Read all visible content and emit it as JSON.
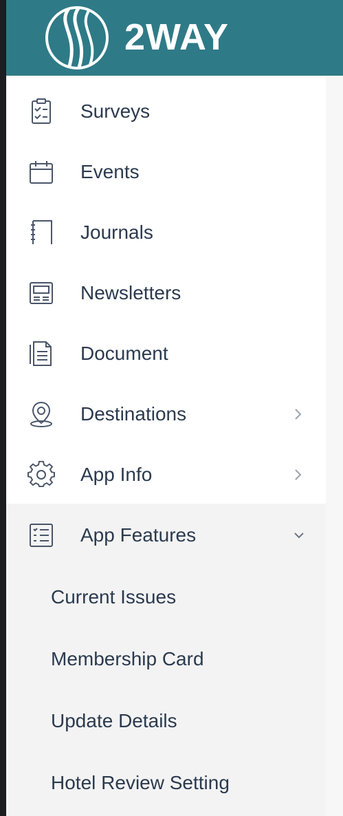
{
  "brand": {
    "name": "2WAY",
    "logo_icon": "wave-logo-icon",
    "color": "#2f7a87"
  },
  "nav": {
    "items": [
      {
        "label": "Surveys",
        "icon": "survey-clipboard-icon"
      },
      {
        "label": "Events",
        "icon": "calendar-icon"
      },
      {
        "label": "Journals",
        "icon": "journal-icon"
      },
      {
        "label": "Newsletters",
        "icon": "newsletter-icon"
      },
      {
        "label": "Document",
        "icon": "document-icon"
      },
      {
        "label": "Destinations",
        "icon": "map-pin-icon",
        "has_children": true
      },
      {
        "label": "App Info",
        "icon": "gear-icon",
        "has_children": true
      },
      {
        "label": "App Features",
        "icon": "list-icon",
        "has_children": true,
        "expanded": true
      }
    ],
    "subitems": [
      {
        "label": "Current Issues"
      },
      {
        "label": "Membership Card"
      },
      {
        "label": "Update Details"
      },
      {
        "label": "Hotel Review Setting"
      }
    ]
  },
  "colors": {
    "text": "#2b3a4e",
    "icon": "#4a5568",
    "expanded_bg": "#f3f3f3"
  }
}
